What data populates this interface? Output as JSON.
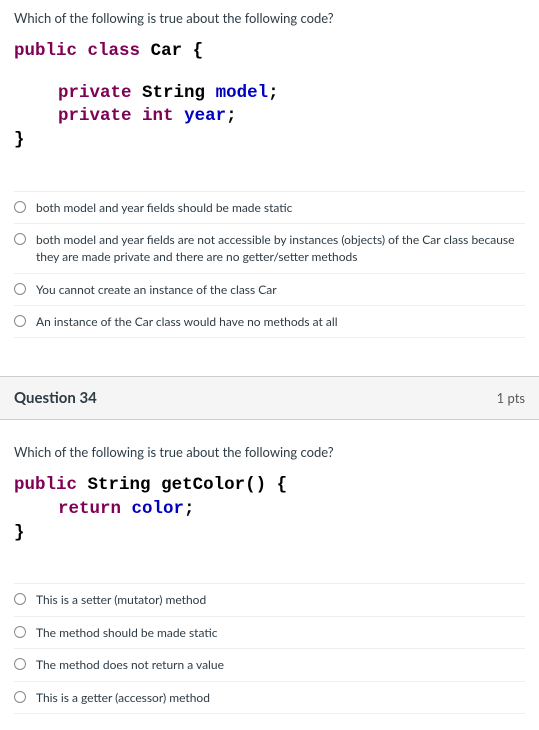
{
  "q33": {
    "prompt": "Which of the following is true about the following code?",
    "code": {
      "l1_public": "public",
      "l1_class": "class",
      "l1_name": "Car",
      "l1_brace": "{",
      "l2_private": "private",
      "l2_type": "String",
      "l2_ident": "model",
      "l2_semi": ";",
      "l3_private": "private",
      "l3_type": "int",
      "l3_ident": "year",
      "l3_semi": ";",
      "l4_brace": "}"
    },
    "options": [
      "both model and year fields should be made static",
      "both model and year fields are not accessible by instances (objects) of the Car class because they are made private and there are no getter/setter methods",
      "You cannot create an instance of the class Car",
      "An instance of the Car class would have no methods at all"
    ]
  },
  "q34": {
    "header": "Question 34",
    "pts": "1 pts",
    "prompt": "Which of the following is true about the following code?",
    "code": {
      "l1_public": "public",
      "l1_type": "String",
      "l1_method": "getColor()",
      "l1_brace": "{",
      "l2_return": "return",
      "l2_ident": "color",
      "l2_semi": ";",
      "l3_brace": "}"
    },
    "options": [
      "This is a setter (mutator) method",
      "The method should be made static",
      "The method does not return a value",
      "This is a getter (accessor) method"
    ]
  }
}
